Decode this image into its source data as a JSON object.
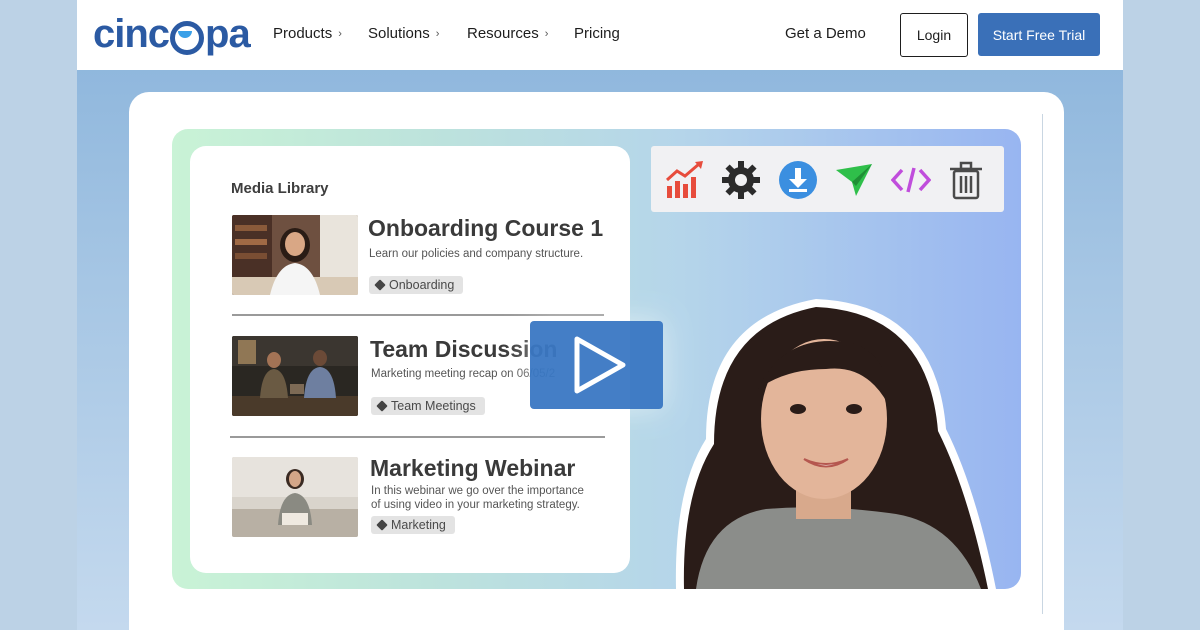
{
  "nav": {
    "logo_text": "cincopa",
    "items": [
      {
        "label": "Products",
        "has_chevron": true
      },
      {
        "label": "Solutions",
        "has_chevron": true
      },
      {
        "label": "Resources",
        "has_chevron": true
      },
      {
        "label": "Pricing",
        "has_chevron": false
      }
    ],
    "chevron": "›",
    "demo_label": "Get a Demo",
    "login_label": "Login",
    "trial_label": "Start Free Trial"
  },
  "library": {
    "title": "Media Library",
    "items": [
      {
        "title": "Onboarding Course 1",
        "description": "Learn our policies and company structure.",
        "tag": "Onboarding"
      },
      {
        "title": "Team Discussion",
        "description": "Marketing meeting recap on 06/05/2",
        "tag": "Team Meetings"
      },
      {
        "title": "Marketing Webinar",
        "description_lines": [
          "In this webinar we go over the importance",
          "of using video in your marketing strategy."
        ],
        "tag": "Marketing"
      }
    ]
  },
  "toolbar": {
    "icons": [
      "analytics-icon",
      "settings-gear-icon",
      "download-icon",
      "share-send-icon",
      "embed-code-icon",
      "trash-icon"
    ]
  },
  "colors": {
    "brand_blue": "#2b5aa3",
    "trial_button": "#3a70b8",
    "play_button": "#3a78c4"
  }
}
